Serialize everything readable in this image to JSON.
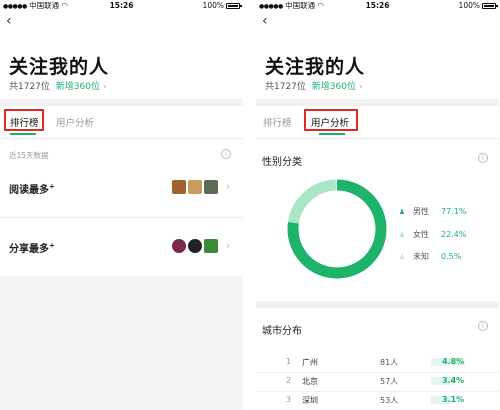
{
  "status_bar": {
    "carrier": "中国联通",
    "signal": "●●●●●",
    "time": "15:26",
    "battery": "100%"
  },
  "header": {
    "back_glyph": "‹",
    "title": "关注我的人",
    "total": "共1727位",
    "new": "新增360位",
    "arrow": "›"
  },
  "tabs": [
    {
      "label": "排行榜"
    },
    {
      "label": "用户分析"
    }
  ],
  "ranking": {
    "note": "近15天数据",
    "rows": [
      {
        "label": "阅读最多",
        "mark": "+"
      },
      {
        "label": "分享最多",
        "mark": "+"
      }
    ]
  },
  "gender": {
    "title": "性别分类",
    "items": [
      {
        "label": "男性",
        "value": "77.1%",
        "fraction": 0.771
      },
      {
        "label": "女性",
        "value": "22.4%",
        "fraction": 0.224
      },
      {
        "label": "未知",
        "value": "0.5%",
        "fraction": 0.005
      }
    ]
  },
  "city": {
    "title": "城市分布",
    "rows": [
      {
        "rank": "1",
        "city": "广州",
        "count": "81人",
        "pct": "4.8%",
        "fraction": 0.048
      },
      {
        "rank": "2",
        "city": "北京",
        "count": "57人",
        "pct": "3.4%",
        "fraction": 0.034
      },
      {
        "rank": "3",
        "city": "深圳",
        "count": "53人",
        "pct": "3.1%",
        "fraction": 0.031
      }
    ]
  },
  "colors": {
    "accent": "#1db36b",
    "female": "#a9e5c6",
    "highlight": "#e02a2a"
  },
  "icons": {
    "info": "info-icon",
    "male": "person-icon",
    "female": "person-icon",
    "unknown": "person-icon",
    "chevron": "chevron-right-icon"
  }
}
